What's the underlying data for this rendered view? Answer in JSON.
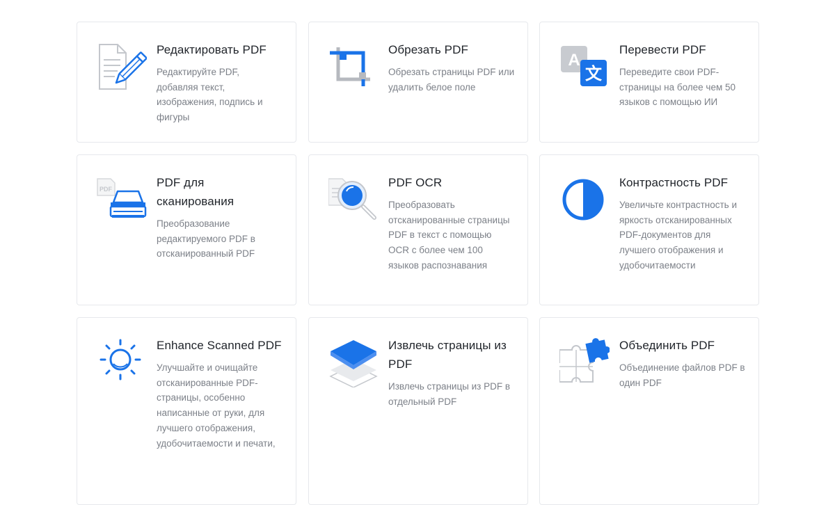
{
  "tools": [
    {
      "title": "Редактировать PDF",
      "desc": "Редактируйте PDF, добавляя текст, изображения, подпись и фигуры",
      "icon": "edit-pdf-icon"
    },
    {
      "title": "Обрезать PDF",
      "desc": "Обрезать страницы PDF или удалить белое поле",
      "icon": "crop-icon"
    },
    {
      "title": "Перевести PDF",
      "desc": "Переведите свои PDF-страницы на более чем 50 языков с помощью ИИ",
      "icon": "translate-icon"
    },
    {
      "title": "PDF для сканирования",
      "desc": "Преобразование редактируемого PDF в отсканированный PDF",
      "icon": "scanner-icon"
    },
    {
      "title": "PDF OCR",
      "desc": "Преобразовать отсканированные страницы PDF в текст с помощью OCR с более чем 100 языков распознавания",
      "icon": "ocr-magnifier-icon"
    },
    {
      "title": "Контрастность PDF",
      "desc": "Увеличьте контрастность и яркость отсканированных PDF-документов для лучшего отображения и удобочитаемости",
      "icon": "contrast-icon"
    },
    {
      "title": "Enhance Scanned PDF",
      "desc": "Улучшайте и очищайте отсканированные PDF-страницы, особенно написанные от руки, для лучшего отображения, удобочитаемости и печати,",
      "icon": "sun-enhance-icon"
    },
    {
      "title": "Извлечь страницы из PDF",
      "desc": "Извлечь страницы из PDF в отдельный PDF",
      "icon": "layers-extract-icon"
    },
    {
      "title": "Объединить PDF",
      "desc": "Объединение файлов PDF в один PDF",
      "icon": "puzzle-merge-icon"
    }
  ],
  "icon_glyphs": {
    "translate_latin": "A",
    "translate_cjk": "文",
    "scanner_doc": "PDF"
  },
  "colors": {
    "accent": "#1a73e8",
    "icon_gray": "#b6b9bf",
    "title": "#1f2329",
    "desc": "#7c8088",
    "border": "#e6e8ec"
  }
}
